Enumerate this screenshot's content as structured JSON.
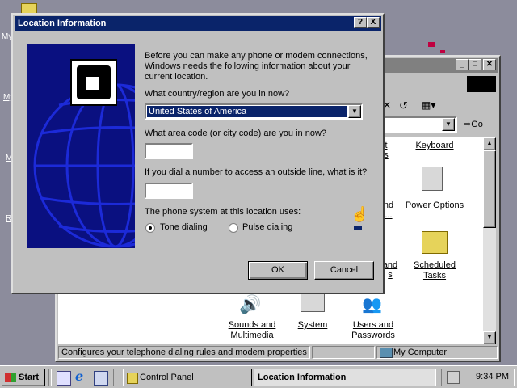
{
  "desktop": {
    "icon_labels": [
      "My",
      "My",
      "M",
      "R"
    ]
  },
  "control_panel": {
    "items": [
      {
        "label_1": "Keyboard",
        "label_2": ""
      },
      {
        "label_1": "Power Options",
        "label_2": ""
      },
      {
        "label_1": "Scheduled",
        "label_2": "Tasks"
      },
      {
        "label_1": "Sounds and",
        "label_2": "Multimedia"
      },
      {
        "label_1": "System",
        "label_2": ""
      },
      {
        "label_1": "Users and",
        "label_2": "Passwords"
      }
    ],
    "partial_labels": [
      "t",
      "s",
      "nd",
      "...",
      "and",
      "s"
    ],
    "go_label": "Go",
    "status_text": "Configures your telephone dialing rules and modem properties",
    "status_location": "My Computer"
  },
  "dialog": {
    "title": "Location Information",
    "help_label": "?",
    "close_label": "X",
    "intro_text": "Before you can make any phone or modem connections, Windows needs the following information about your current location.",
    "country_question": "What country/region are you in now?",
    "country_value": "United States of America",
    "area_code_question": "What area code (or city code) are you in now?",
    "area_code_value": "",
    "outside_line_question": "If you dial a number to access an outside line, what is it?",
    "outside_line_value": "",
    "phone_system_label": "The phone system at this location uses:",
    "tone_label": "Tone dialing",
    "pulse_label": "Pulse dialing",
    "selected_dialing": "tone",
    "ok_label": "OK",
    "cancel_label": "Cancel"
  },
  "taskbar": {
    "start_label": "Start",
    "tasks": [
      {
        "label": "Control Panel",
        "active": false
      },
      {
        "label": "Location Information",
        "active": true
      }
    ],
    "clock": "9:34 PM"
  }
}
